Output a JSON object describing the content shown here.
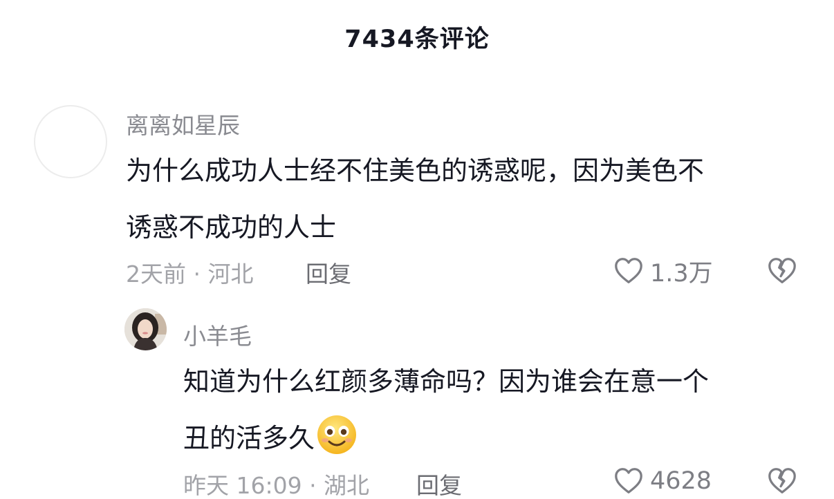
{
  "header": {
    "title": "7434条评论"
  },
  "comments": [
    {
      "username": "离离如星辰",
      "text_line1": "为什么成功人士经不住美色的诱惑呢，因为美色不",
      "text_line2": "诱惑不成功的人士",
      "time_location": "2天前 · 河北",
      "reply_label": "回复",
      "likes": "1.3万",
      "avatar": "blank-avatar"
    },
    {
      "username": "小羊毛",
      "text_line1": "知道为什么红颜多薄命吗？因为谁会在意一个",
      "text_line2": "丑的活多久",
      "emoji": "smiling-face-emoji",
      "time_location": "昨天 16:09 · 湖北",
      "reply_label": "回复",
      "likes": "4628",
      "avatar": "user-photo-avatar"
    }
  ],
  "icons": {
    "like": "heart-outline-icon",
    "dislike": "broken-heart-icon"
  },
  "colors": {
    "primary_text": "#161823",
    "secondary_text": "#a2a3a8",
    "username": "#8a8b91",
    "icon": "#7d7e84"
  }
}
